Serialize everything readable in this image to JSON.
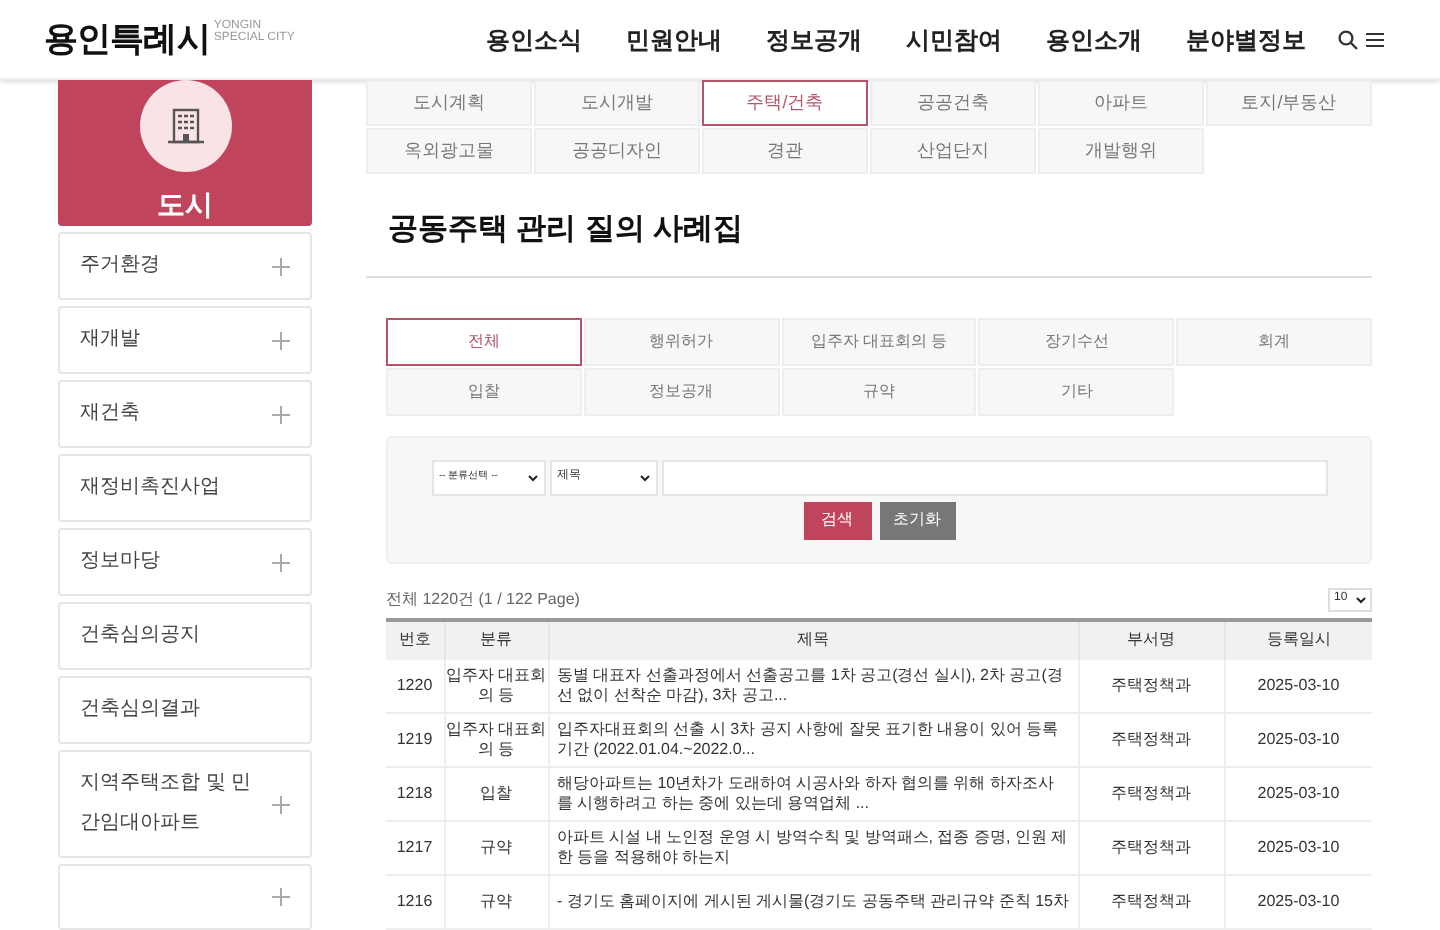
{
  "logo": {
    "text": "용인특례시",
    "sub_top": "YONGIN",
    "sub_bottom": "SPECIAL CITY"
  },
  "nav": [
    "용인소식",
    "민원안내",
    "정보공개",
    "시민참여",
    "용인소개",
    "분야별정보"
  ],
  "sidebar": {
    "title": "도시",
    "items": [
      {
        "label": "주거환경",
        "expandable": true
      },
      {
        "label": "재개발",
        "expandable": true
      },
      {
        "label": "재건축",
        "expandable": true
      },
      {
        "label": "재정비촉진사업",
        "expandable": false
      },
      {
        "label": "정보마당",
        "expandable": true
      },
      {
        "label": "건축심의공지",
        "expandable": false
      },
      {
        "label": "건축심의결과",
        "expandable": false
      },
      {
        "label": "지역주택조합 및 민간임대아파트",
        "expandable": true
      },
      {
        "expandable": true
      }
    ]
  },
  "category_tabs": [
    {
      "label": "도시계획",
      "selected": false
    },
    {
      "label": "도시개발",
      "selected": false
    },
    {
      "label": "주택/건축",
      "selected": true
    },
    {
      "label": "공공건축",
      "selected": false
    },
    {
      "label": "아파트",
      "selected": false
    },
    {
      "label": "토지/부동산",
      "selected": false
    },
    {
      "label": "옥외광고물",
      "selected": false
    },
    {
      "label": "공공디자인",
      "selected": false
    },
    {
      "label": "경관",
      "selected": false
    },
    {
      "label": "산업단지",
      "selected": false
    },
    {
      "label": "개발행위",
      "selected": false
    }
  ],
  "page_title": "공동주택 관리 질의 사례집",
  "sub_tabs": [
    {
      "label": "전체",
      "selected": true
    },
    {
      "label": "행위허가",
      "selected": false
    },
    {
      "label": "입주자 대표회의 등",
      "selected": false
    },
    {
      "label": "장기수선",
      "selected": false
    },
    {
      "label": "회계",
      "selected": false
    },
    {
      "label": "입찰",
      "selected": false
    },
    {
      "label": "정보공개",
      "selected": false
    },
    {
      "label": "규약",
      "selected": false
    },
    {
      "label": "기타",
      "selected": false
    }
  ],
  "search": {
    "category_select": "-- 분류선택 --",
    "field_select": "제목",
    "search_button": "검색",
    "reset_button": "초기화"
  },
  "summary": "전체 1220건 (1 / 122 Page)",
  "page_size": "10",
  "table": {
    "columns": [
      "번호",
      "분류",
      "제목",
      "부서명",
      "등록일시"
    ],
    "rows": [
      [
        "1220",
        "입주자 대표회의 등",
        "동별 대표자 선출과정에서 선출공고를 1차 공고(경선 실시), 2차 공고(경선 없이 선착순 마감), 3차 공고...",
        "주택정책과",
        "2025-03-10"
      ],
      [
        "1219",
        "입주자 대표회의 등",
        "입주자대표회의 선출 시 3차 공지 사항에 잘못 표기한 내용이 있어 등록기간 (2022.01.04.~2022.0...",
        "주택정책과",
        "2025-03-10"
      ],
      [
        "1218",
        "입찰",
        "해당아파트는 10년차가 도래하여 시공사와 하자 협의를 위해 하자조사를 시행하려고 하는 중에 있는데 용역업체 ...",
        "주택정책과",
        "2025-03-10"
      ],
      [
        "1217",
        "규약",
        "아파트 시설 내 노인정 운영 시 방역수칙 및 방역패스, 접종 증명, 인원 제한 등을 적용해야 하는지",
        "주택정책과",
        "2025-03-10"
      ],
      [
        "1216",
        "규약",
        "- 경기도 홈페이지에 게시된 게시물(경기도 공동주택 관리규약 준칙 15차",
        "주택정책과",
        "2025-03-10"
      ]
    ]
  }
}
